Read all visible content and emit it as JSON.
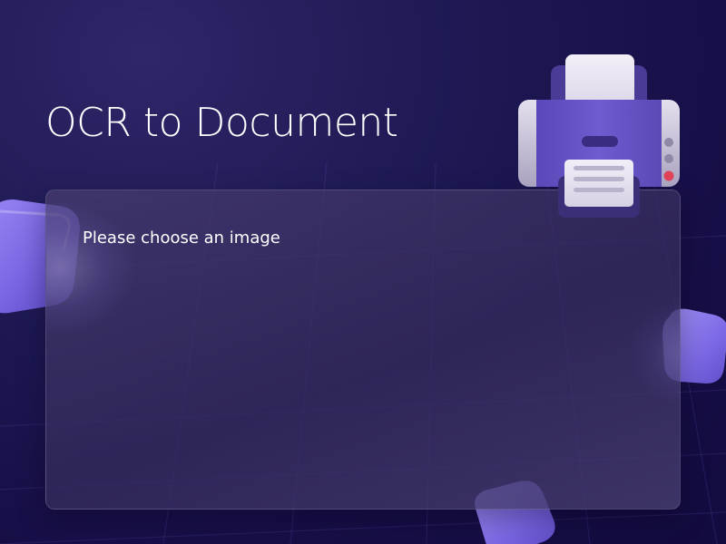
{
  "app": {
    "title": "OCR to Document"
  },
  "panel": {
    "status_text": "Please choose an image"
  },
  "icons": {
    "printer": "printer-icon"
  },
  "colors": {
    "background": "#170f47",
    "panel": "#3a3170",
    "accent": "#6f5fd8",
    "cube": "#7a68e6",
    "printer_body": "#6a58c8",
    "printer_light_red": "#e04258"
  }
}
